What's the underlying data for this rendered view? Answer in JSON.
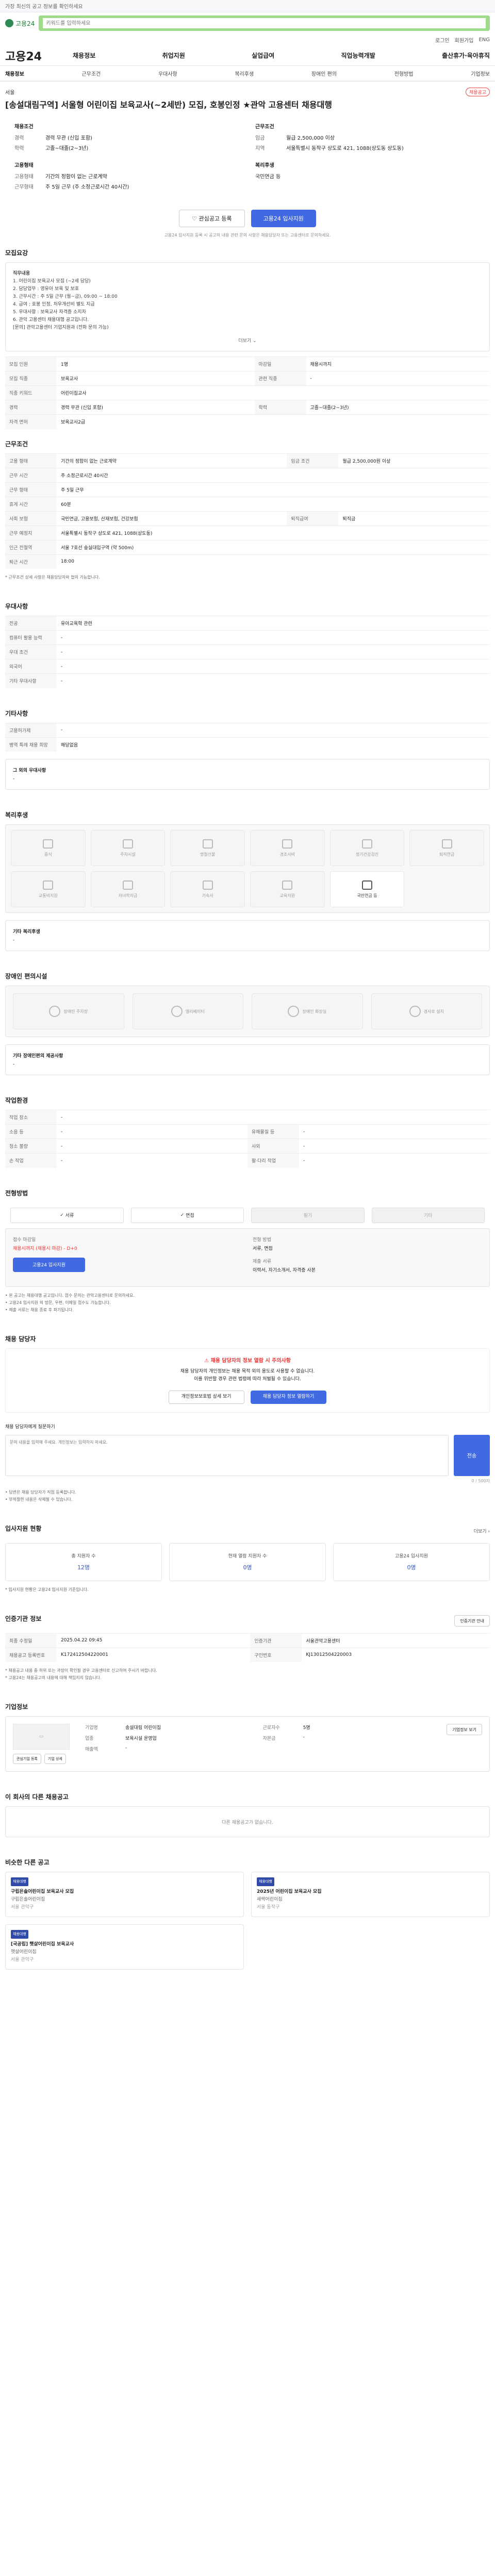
{
  "notice": "가장 최신의 공고 정보를 확인하세요",
  "header": {
    "logo_text": "고용24",
    "search_placeholder": "키워드를 입력하세요",
    "util": [
      "로그인",
      "회원가입",
      "ENG"
    ]
  },
  "gnb": {
    "brand": "고용24",
    "menu": [
      "채용정보",
      "취업지원",
      "실업급여",
      "직업능력개발",
      "출산휴가·육아휴직"
    ]
  },
  "tabs": [
    "채용정보",
    "근무조건",
    "우대사항",
    "복리후생",
    "장애인 편의",
    "전형방법",
    "기업정보"
  ],
  "hero": {
    "location_tag": "서울",
    "badge": "채용공고",
    "title": "[송설대림구역] 서울형 어린이집 보육교사(~2세반) 모집, 호봉인정 ★관악 고용센터 채용대행",
    "left_title": "채용조건",
    "left": [
      {
        "k": "경력",
        "v": "경력 무관 (신입 포함)"
      },
      {
        "k": "학력",
        "v": "고졸~대졸(2~3년)"
      }
    ],
    "left2_title": "고용형태",
    "left2": [
      {
        "k": "고용형태",
        "v": "기간의 정함이 없는 근로계약"
      },
      {
        "k": "근무형태",
        "v": "주 5일 근무 (주 소정근로시간 40시간)"
      }
    ],
    "right_title": "근무조건",
    "right": [
      {
        "k": "임금",
        "v": "월급 2,500,000 이상"
      },
      {
        "k": "지역",
        "v": "서울특별시 동작구 상도로 421, 1088(상도동 상도동)"
      }
    ],
    "right2_title": "복리후생",
    "right2": [
      {
        "k": "",
        "v": "국민연금 등"
      }
    ],
    "btn_outline": "관심공고 등록",
    "btn_primary": "고용24 입사지원",
    "note": "고용24 입사지원 등록 시 공고의 내용 관련 문의 사항은 채용담당자 또는 고용센터로 문의하세요."
  },
  "job_desc": {
    "title": "모집요강",
    "lines": [
      "직무내용",
      "1. 어린이집 보육교사 모집 (~2세 담당)",
      "2. 담당업무 : 영유아 보육 및 보호",
      "3. 근무시간 : 주 5일 근무 (월~금), 09:00 ~ 18:00",
      "4. 급여 : 호봉 인정, 처우개선비 별도 지급",
      "5. 우대사항 : 보육교사 자격증 소지자",
      "6. 관악 고용센터 채용대행 공고입니다.",
      "[문의] 관악고용센터 기업지원과 (전화 문의 가능)"
    ],
    "more": "더보기"
  },
  "recruit_table": [
    {
      "k": "모집 인원",
      "v": "1명",
      "k2": "마감일",
      "v2": "채용시까지"
    },
    {
      "k": "모집 직종",
      "v": "보육교사",
      "k2": "관련 직종",
      "v2": "-"
    },
    {
      "k": "직종 키워드",
      "v": "어린이집교사",
      "k2": "",
      "v2": ""
    },
    {
      "k": "경력",
      "v": "경력 무관 (신입 포함)",
      "k2": "학력",
      "v2": "고졸~대졸(2~3년)"
    },
    {
      "k": "자격 면허",
      "v": "보육교사2급",
      "k2": "",
      "v2": ""
    }
  ],
  "work_cond": {
    "title": "근무조건",
    "rows": [
      {
        "k": "고용 형태",
        "v": "기간의 정함이 없는 근로계약",
        "k2": "임금 조건",
        "v2": "월급 2,500,000원 이상"
      },
      {
        "k": "근무 시간",
        "v": "주 소정근로시간 40시간"
      },
      {
        "k": "근무 형태",
        "v": "주 5일 근무"
      },
      {
        "k": "휴게 시간",
        "v": "60분"
      },
      {
        "k": "사회 보험",
        "v": "국민연금, 고용보험, 산재보험, 건강보험",
        "k2": "퇴직급여",
        "v2": "퇴직금"
      },
      {
        "k": "근무 예정지",
        "v": "서울특별시 동작구 상도로 421, 1088(상도동)"
      },
      {
        "k": "인근 전철역",
        "v": "서울 7호선 숭실대입구역 (약 500m)"
      },
      {
        "k": "퇴근 시간",
        "v": "18:00"
      }
    ],
    "note": "* 근무조건 상세 사항은 채용담당자와 협의 가능합니다."
  },
  "prefer": {
    "title": "우대사항",
    "rows": [
      {
        "k": "전공",
        "v": "유아교육학 관련"
      },
      {
        "k": "컴퓨터 활용 능력",
        "v": "-"
      },
      {
        "k": "우대 조건",
        "v": "-"
      },
      {
        "k": "외국어",
        "v": "-"
      },
      {
        "k": "기타 우대사항",
        "v": "-"
      }
    ]
  },
  "etc": {
    "title": "기타사항",
    "rows": [
      {
        "k": "고용허가제",
        "v": "-"
      },
      {
        "k": "병역 특례 채용 희망",
        "v": "해당없음"
      }
    ],
    "more_title": "그 외의 우대사항",
    "more_value": "-"
  },
  "welfare": {
    "title": "복리후생",
    "items": [
      "중식",
      "주차시설",
      "명절선물",
      "경조사비",
      "정기건강검진",
      "퇴직연금",
      "교통비지원",
      "자녀학자금",
      "기숙사",
      "교육지원",
      "국민연금 등"
    ],
    "active": 10,
    "other_title": "기타 복리후생",
    "other_value": "-"
  },
  "disability": {
    "title": "장애인 편의시설",
    "items": [
      "장애인 주차장",
      "엘리베이터",
      "장애인 화장실",
      "경사로 설치"
    ],
    "other_title": "기타 장애인편의 제공사항",
    "other_value": "-"
  },
  "work_env": {
    "title": "작업환경",
    "rows": [
      {
        "k": "작업 장소",
        "v": "-"
      },
      {
        "k": "소음 등",
        "v": "-",
        "k2": "유해물질 등",
        "v2": "-"
      },
      {
        "k": "청소 불량",
        "v": "-",
        "k2": "사외",
        "v2": "-"
      },
      {
        "k": "손 작업",
        "v": "-",
        "k2": "팔·다리 작업",
        "v2": "-"
      }
    ]
  },
  "selection": {
    "title": "전형방법",
    "options": [
      "서류",
      "면접",
      "필기",
      "기타"
    ],
    "apply_k": "접수 마감일",
    "apply_v": "채용시까지 (채용시 마감) - D+0",
    "method_k": "전형 방법",
    "method_v": "서류, 면접",
    "doc_k": "제출 서류",
    "doc_v": "이력서, 자기소개서, 자격증 사본",
    "btn": "고용24 입사지원",
    "notes": [
      "• 본 공고는 채용대행 공고입니다. 접수 문의는 관악고용센터로 문의하세요.",
      "• 고용24 입사지원 외 방문, 우편, 이메일 접수도 가능합니다.",
      "• 제출 서류는 채용 종료 후 파기됩니다."
    ]
  },
  "contact": {
    "title": "채용 담당자",
    "alert_title": "채용 담당자의 정보 열람 시 주의사항",
    "alert_lines": [
      "채용 담당자의 개인정보는 채용 목적 외의 용도로 사용할 수 없습니다.",
      "이를 위반할 경우 관련 법령에 따라 처벌될 수 있습니다."
    ],
    "btn_outline": "개인정보보호법 상세 보기",
    "btn_primary": "채용 담당자 정보 열람하기",
    "inquiry_title": "채용 담당자에게 질문하기",
    "inquiry_placeholder": "문의 내용을 입력해 주세요. 개인정보는 입력하지 마세요.",
    "inquiry_btn": "전송",
    "inquiry_count": "0 / 500자",
    "inquiry_notes": [
      "• 답변은 채용 담당자가 직접 등록합니다.",
      "• 부적절한 내용은 삭제될 수 있습니다."
    ]
  },
  "stats": {
    "title": "입사지원 현황",
    "more": "더보기",
    "items": [
      {
        "label": "총 지원자 수",
        "value": "12명"
      },
      {
        "label": "현재 열람 지원자 수",
        "value": "0명"
      },
      {
        "label": "고용24 입사지원",
        "value": "0명"
      }
    ],
    "note": "* 입사지원 현황은 고용24 입사지원 기준입니다."
  },
  "company_meta": {
    "title": "인증기관 정보",
    "btn": "인증기관 안내",
    "rows": [
      {
        "k": "최종 수정일",
        "v": "2025.04.22 09:45",
        "k2": "인증기관",
        "v2": "서울관악고용센터"
      },
      {
        "k": "채용공고 등록번호",
        "v": "K172412504220001",
        "k2": "구인번호",
        "v2": "KJ13012504220003"
      }
    ],
    "notes": [
      "* 채용공고 내용 중 허위 또는 과장이 확인될 경우 고용센터로 신고하여 주시기 바랍니다.",
      "* 고용24는 채용공고의 내용에 대해 책임지지 않습니다."
    ]
  },
  "company": {
    "title": "기업정보",
    "name_k": "기업명",
    "name_v": "송설대림 어린이집",
    "type_k": "업종",
    "type_v": "보육시설 운영업",
    "emp_k": "근로자수",
    "emp_v": "5명",
    "cap_k": "자본금",
    "cap_v": "-",
    "sales_k": "매출액",
    "sales_v": "-",
    "btn": "기업정보 보기",
    "sub_buttons": [
      "관심기업 등록",
      "기업 상세"
    ]
  },
  "other_jobs": {
    "title": "이 회사의 다른 채용공고",
    "empty": "다른 채용공고가 없습니다."
  },
  "similar": {
    "title": "비슷한 다른 공고",
    "cards": [
      {
        "badge": "채용대행",
        "title": "구립은솔어린이집 보육교사 모집",
        "company": "구립은솔어린이집",
        "loc": "서울 관악구"
      },
      {
        "badge": "채용대행",
        "title": "2025년 어린이집 보육교사 모집",
        "company": "새싹어린이집",
        "loc": "서울 동작구"
      },
      {
        "badge": "채용대행",
        "title": "[국공립] 햇살어린이집 보육교사",
        "company": "햇살어린이집",
        "loc": "서울 관악구"
      }
    ]
  },
  "colors": {
    "accent": "#4169e1",
    "search": "#9ddb8a",
    "alert": "#e33333"
  }
}
